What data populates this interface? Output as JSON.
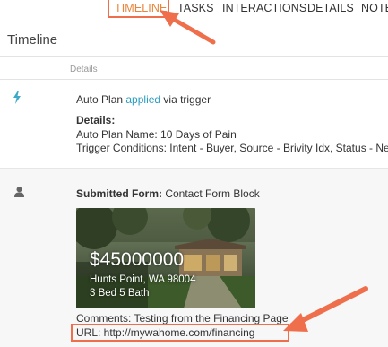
{
  "tabs": [
    {
      "label": "TIMELINE",
      "active": true
    },
    {
      "label": "TASKS",
      "active": false
    },
    {
      "label": "INTERACTIONS",
      "active": false
    },
    {
      "label": "DETAILS",
      "active": false
    },
    {
      "label": "NOTES",
      "active": false
    }
  ],
  "page_title": "Timeline",
  "column_header": "Details",
  "entries": [
    {
      "icon": "bolt-icon",
      "summary_prefix": "Auto Plan ",
      "summary_link": "applied",
      "summary_suffix": " via trigger",
      "details_heading": "Details:",
      "auto_plan_name": "Auto Plan Name: 10 Days of Pain",
      "trigger_conditions": "Trigger Conditions: Intent - Buyer, Source - Brivity Idx, Status - New"
    },
    {
      "icon": "user-icon",
      "form_label": "Submitted Form:",
      "form_name": " Contact Form Block",
      "property": {
        "price": "$45000000",
        "address": "Hunts Point, WA 98004",
        "beds_baths": "3 Bed 5 Bath"
      },
      "comments": "Comments: Testing from the Financing Page",
      "url": "URL: http://mywahome.com/financing"
    }
  ],
  "colors": {
    "accent_orange": "#e8853a",
    "link_blue": "#2a9dc2",
    "annotation_red": "#ef6f4c"
  }
}
